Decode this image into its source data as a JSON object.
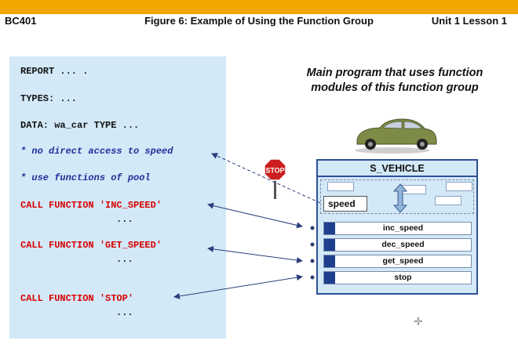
{
  "header": {
    "course": "BC401",
    "figure_title": "Figure 6: Example of Using the Function Group",
    "unit": "Unit 1 Lesson 1"
  },
  "code": {
    "report": "REPORT ... .",
    "types": "TYPES: ...",
    "data": "DATA: wa_car TYPE ...",
    "comment_1": "* no direct access to speed",
    "comment_2": "* use functions of pool",
    "call_1": "CALL FUNCTION 'INC_SPEED'",
    "call_1_more": "...",
    "call_2": "CALL FUNCTION 'GET_SPEED'",
    "call_2_more": "...",
    "call_3": "CALL FUNCTION 'STOP'",
    "call_3_more": "..."
  },
  "main_program_caption": "Main program that uses function modules of this function group",
  "stop_sign": "STOP",
  "vehicle": {
    "name": "S_VEHICLE",
    "attribute": "speed",
    "functions": [
      "inc_speed",
      "dec_speed",
      "get_speed",
      "stop"
    ]
  },
  "colors": {
    "top_bar": "#f0a800",
    "code_background": "#d3e9f8",
    "comment_text": "#1f2f99",
    "call_text": "#d80000",
    "vehicle_border": "#2e4f98",
    "car_body": "#7d8b47",
    "stop_sign": "#cc1e1e"
  }
}
